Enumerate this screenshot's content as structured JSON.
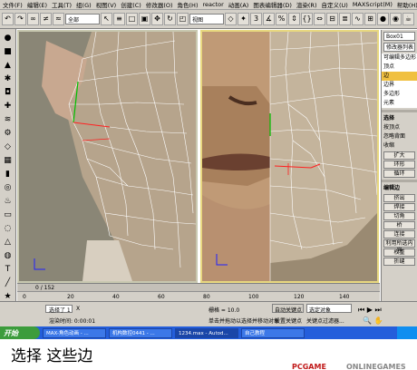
{
  "menu": [
    "文件(F)",
    "编辑(E)",
    "工具(T)",
    "组(G)",
    "视图(V)",
    "创建(C)",
    "修改器(O)",
    "角色(H)",
    "reactor",
    "动画(A)",
    "图表编辑器(D)",
    "渲染(R)",
    "自定义(U)",
    "MAXScript(M)",
    "帮助(H)"
  ],
  "toolbar": {
    "filter_value": "全部",
    "view_value": "视图"
  },
  "viewports": {
    "left_label": "",
    "right_label": ""
  },
  "timeline": {
    "frame_label": "0 / 152"
  },
  "ruler": {
    "ticks": [
      "0",
      "20",
      "40",
      "60",
      "80",
      "100",
      "120",
      "140"
    ]
  },
  "command_panel": {
    "object_name": "Box01",
    "modifier_list": "修改器列表",
    "rows": [
      "可编辑多边形",
      "顶点",
      "边",
      "边界",
      "多边形",
      "元素"
    ],
    "sel_section": "选择",
    "checks": [
      "按顶点",
      "忽略背面",
      "收缩"
    ],
    "buttons": [
      "扩大",
      "环形",
      "循环"
    ],
    "edit_section": "编辑边",
    "edit_buttons": [
      "挤出",
      "焊接",
      "切角",
      "桥",
      "连接",
      "利用所选内容",
      "权重",
      "折缝"
    ]
  },
  "status": {
    "selected": "选择了 1",
    "lock": "X",
    "render_time": "渲染时间: 0:00:01",
    "prompt": "单击并拖动以选择并移动对象",
    "grid": "栅格 = 10.0",
    "autokey": "自动关键点",
    "set_key": "设置关键点",
    "selected_obj": "选定对象",
    "key_filter": "关键点过滤器..."
  },
  "taskbar": {
    "start": "开始",
    "tasks": [
      "MAX-角色动画 - ...",
      "机构数控0441 - ...",
      "1234.max - Autod...",
      "自己教程"
    ]
  },
  "caption": "选择 这些边",
  "watermark": {
    "brand": "PCGAME",
    "site": "ONLINEGAMES"
  },
  "colors": {
    "ui_gray": "#d4d0c8",
    "taskbar_blue": "#245edb",
    "start_green": "#3c9c3c",
    "active_viewport": "#e8d880"
  }
}
